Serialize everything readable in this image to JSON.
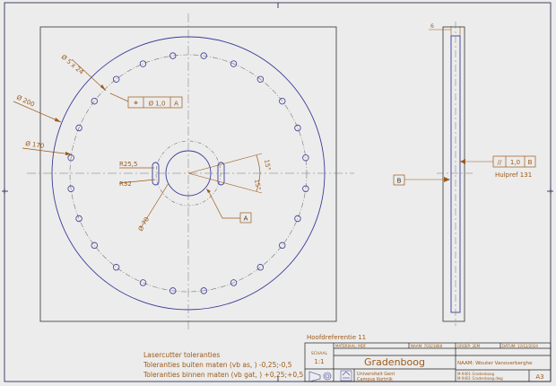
{
  "drawing": {
    "colors": {
      "paper": "#ececec",
      "frame": "#1a1a4a",
      "geometry": "#5a5aa8",
      "dimension": "#9c5a1a",
      "centerline": "#777777",
      "border": "#222222"
    },
    "dimensions": {
      "holes": "Ø 5 x 24",
      "outer_diameter": "Ø 200",
      "bolt_circle": "Ø 170",
      "slot_radius_inner": "R25,5",
      "slot_radius_outer": "R32",
      "center_bore": "Ø 70",
      "angle_upper": "15°",
      "angle_lower": "15°",
      "thickness": "6"
    },
    "feature_control": {
      "position_symbol": "⌖",
      "position_value": "Ø 1,0",
      "position_datum": "A",
      "parallel_symbol": "//",
      "parallel_value": "1,0",
      "parallel_datum": "B"
    },
    "datums": {
      "a": "A",
      "b": "B"
    },
    "side_note": "Hulpref 131",
    "reference_label": "Hoofdreferentie 11",
    "notes": {
      "title": "Lasercutter toleranties",
      "line1": "Toleranties buiten maten (vb as, ) -0,25;-0,5",
      "line2": "Toleranties binnen maten (vb gat, ) +0,25;+0,5"
    },
    "title_block": {
      "schaal_label": "SCHAAL",
      "schaal_value": "1:1",
      "materiaal": "MATERIAAL: MDF",
      "naam_nr": "NAAM: 70321868",
      "groep": "GROEP: 2EM",
      "datum": "DATUM: 13/12/2024",
      "title": "Gradenboog",
      "naam_full": "NAAM: Wouter Vanoverberghe",
      "university": "Universiteit Gent",
      "campus": "Campus Kortrijk",
      "file1": "M-9401 Gradenboog",
      "file2": "M-9401 Gradenboog.dwg",
      "size": "A3"
    }
  }
}
